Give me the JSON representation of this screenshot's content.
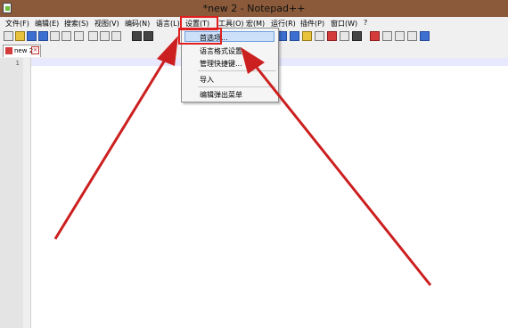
{
  "window": {
    "title": "*new 2 - Notepad++"
  },
  "menu": [
    "文件(F)",
    "编辑(E)",
    "搜索(S)",
    "视图(V)",
    "编码(N)",
    "语言(L)",
    "设置(T)",
    "工具(O)",
    "宏(M)",
    "运行(R)",
    "插件(P)",
    "窗口(W)",
    "?"
  ],
  "tab": {
    "label": "new 2"
  },
  "editor": {
    "line_number": "1"
  },
  "settings_menu": {
    "items": [
      "首选项...",
      "语言格式设置...",
      "管理快捷键...",
      "导入",
      "编辑弹出菜单"
    ]
  },
  "colors": {
    "highlight_box": "#e02020",
    "arrow": "#cc1f1f",
    "menu_selection": "#cde0fa"
  },
  "toolbar_icons": [
    "new-icon",
    "open-icon",
    "save-icon",
    "save-all-icon",
    "close-icon",
    "close-all-icon",
    "print-icon",
    "cut-icon",
    "copy-icon",
    "paste-icon",
    "undo-icon",
    "redo-icon",
    "view-icon",
    "wrap-icon",
    "indent-icon",
    "doc-map-icon",
    "function-list-icon",
    "folder-icon",
    "record-icon",
    "stop-icon",
    "play-icon",
    "play-multiple-icon",
    "save-macro-icon"
  ]
}
